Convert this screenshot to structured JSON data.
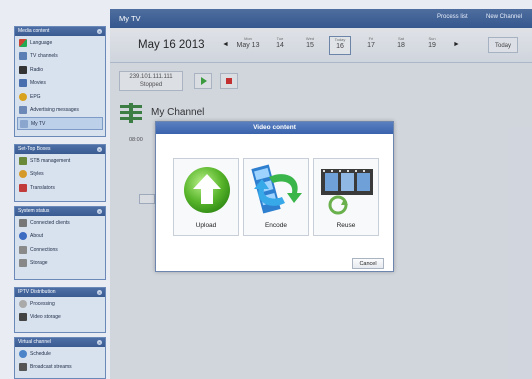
{
  "topbar": {
    "title": "My TV",
    "tabs": [
      "Process list",
      "New Channel"
    ]
  },
  "sidebar": {
    "panels": [
      {
        "title": "Media content",
        "items": [
          "Language",
          "TV channels",
          "Radio",
          "Movies",
          "EPG",
          "Advertising messages",
          "My TV"
        ]
      },
      {
        "title": "Set-Top Boxes",
        "items": [
          "STB management",
          "Styles",
          "Translators"
        ]
      },
      {
        "title": "System status",
        "items": [
          "Connected clients",
          "About",
          "Connections",
          "Storage"
        ]
      },
      {
        "title": "IPTV Distribution",
        "items": [
          "Processing",
          "Video storage"
        ]
      },
      {
        "title": "Virtual channel",
        "items": [
          "Schedule",
          "Broadcast streams"
        ]
      }
    ]
  },
  "datebar": {
    "date": "May 16 2013",
    "prev": "◄",
    "next": "►",
    "days": [
      {
        "dow": "Mon",
        "num": "May 13"
      },
      {
        "dow": "Tue",
        "num": "14"
      },
      {
        "dow": "Wed",
        "num": "15"
      },
      {
        "dow": "Today",
        "num": "16"
      },
      {
        "dow": "Fri",
        "num": "17"
      },
      {
        "dow": "Sat",
        "num": "18"
      },
      {
        "dow": "Sun",
        "num": "19"
      }
    ],
    "today_label": "Today"
  },
  "stream": {
    "ip": "239.101.111.111",
    "status": "Stopped"
  },
  "channel": {
    "title": "My Channel",
    "time": "08:00"
  },
  "modal": {
    "title": "Video content",
    "options": [
      "Upload",
      "Encode",
      "Reuse"
    ],
    "cancel_label": "Cancel"
  },
  "colors": {
    "header_blue": "#3963ad",
    "sidebar_blue": "#3a5b92",
    "play_green": "#2da02d",
    "stop_red": "#d31f1f"
  }
}
